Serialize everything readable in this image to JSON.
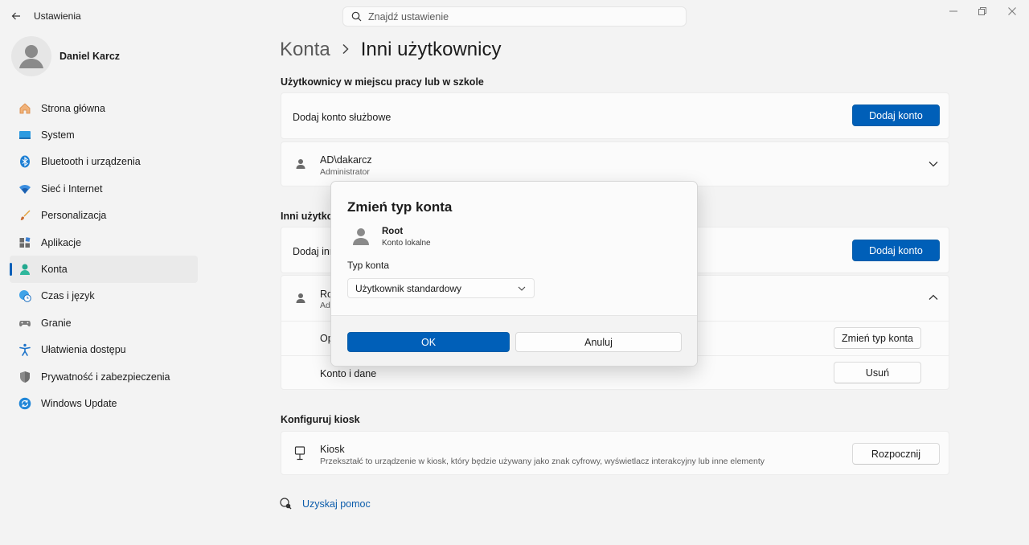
{
  "app": {
    "title": "Ustawienia"
  },
  "search": {
    "placeholder": "Znajdź ustawienie"
  },
  "profile": {
    "name": "Daniel Karcz"
  },
  "sidebar": {
    "items": [
      {
        "label": "Strona główna",
        "icon": "home-icon"
      },
      {
        "label": "System",
        "icon": "display-icon"
      },
      {
        "label": "Bluetooth i urządzenia",
        "icon": "bluetooth-icon"
      },
      {
        "label": "Sieć i Internet",
        "icon": "wifi-icon"
      },
      {
        "label": "Personalizacja",
        "icon": "brush-icon"
      },
      {
        "label": "Aplikacje",
        "icon": "apps-icon"
      },
      {
        "label": "Konta",
        "icon": "account-icon",
        "active": true
      },
      {
        "label": "Czas i język",
        "icon": "globe-clock-icon"
      },
      {
        "label": "Granie",
        "icon": "gamepad-icon"
      },
      {
        "label": "Ułatwienia dostępu",
        "icon": "accessibility-icon"
      },
      {
        "label": "Prywatność i zabezpieczenia",
        "icon": "shield-icon"
      },
      {
        "label": "Windows Update",
        "icon": "update-icon"
      }
    ]
  },
  "breadcrumb": {
    "parent": "Konta",
    "current": "Inni użytkownicy"
  },
  "work_section": {
    "title": "Użytkownicy w miejscu pracy lub w szkole",
    "add_label": "Dodaj konto służbowe",
    "add_button": "Dodaj konto",
    "user": {
      "name": "AD\\dakarcz",
      "role": "Administrator"
    }
  },
  "other_section": {
    "title_visible": "Inni użytkow",
    "add_label_visible": "Dodaj inn",
    "add_button": "Dodaj konto",
    "user": {
      "name_visible": "Ro",
      "role_visible": "Ad"
    },
    "options_label_visible": "Op",
    "change_type_button": "Zmień typ konta",
    "data_label": "Konto i dane",
    "remove_button": "Usuń"
  },
  "kiosk_section": {
    "title": "Konfiguruj kiosk",
    "name": "Kiosk",
    "description": "Przekształć to urządzenie w kiosk, który będzie używany jako znak cyfrowy, wyświetlacz interakcyjny lub inne elementy",
    "button": "Rozpocznij"
  },
  "help": {
    "label": "Uzyskaj pomoc"
  },
  "dialog": {
    "title": "Zmień typ konta",
    "user_name": "Root",
    "user_sub": "Konto lokalne",
    "type_label": "Typ konta",
    "type_value": "Użytkownik standardowy",
    "ok": "OK",
    "cancel": "Anuluj"
  },
  "colors": {
    "accent": "#005fb8",
    "background": "#f3f3f3",
    "card": "#fbfbfb"
  }
}
